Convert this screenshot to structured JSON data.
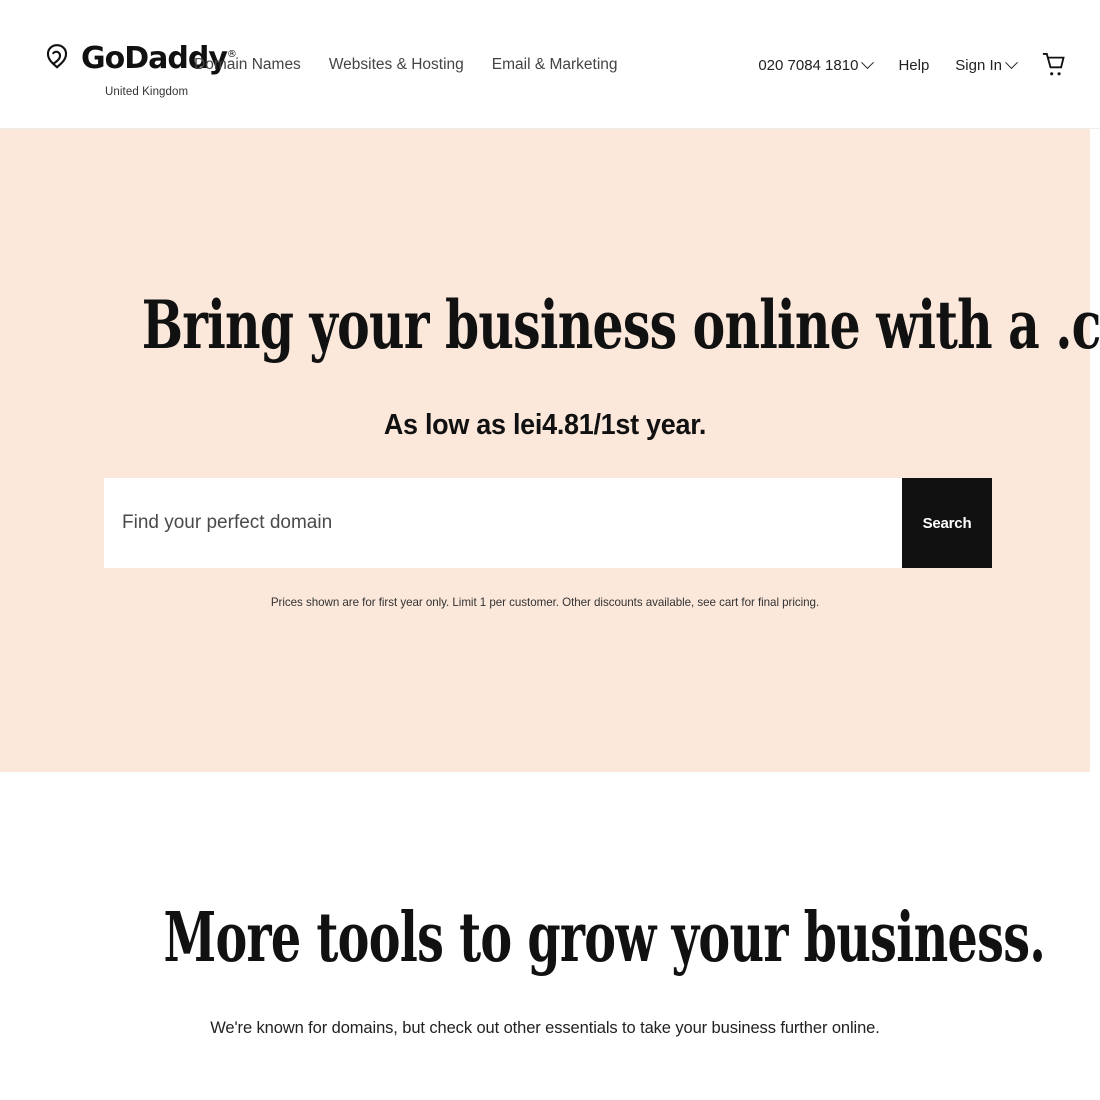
{
  "header": {
    "brand": {
      "logo_icon": "godaddy-heart-mark",
      "wordmark": "GoDaddy",
      "trademark": "®",
      "locale": "United Kingdom"
    },
    "nav": [
      {
        "label": "Domain Names"
      },
      {
        "label": "Websites & Hosting"
      },
      {
        "label": "Email & Marketing"
      }
    ],
    "utility": {
      "phone": "020 7084 1810",
      "phone_chevron_icon": "chevron-down-icon",
      "help": "Help",
      "sign_in": "Sign In",
      "sign_in_chevron_icon": "chevron-down-icon",
      "cart_icon": "shopping-cart-icon"
    }
  },
  "hero": {
    "background_color": "#FCE8DB",
    "title": "Bring your business online with a .com",
    "subtitle": "As low as lei4.81/1st year.",
    "search": {
      "placeholder": "Find your perfect domain",
      "value": "",
      "button_label": "Search"
    },
    "fineprint": "Prices shown are for first year only. Limit 1 per customer. Other discounts available, see cart for final pricing."
  },
  "section_more_tools": {
    "title": "More tools to grow your business.",
    "subtitle": "We're known for domains, but check out other essentials to take your business further online."
  }
}
